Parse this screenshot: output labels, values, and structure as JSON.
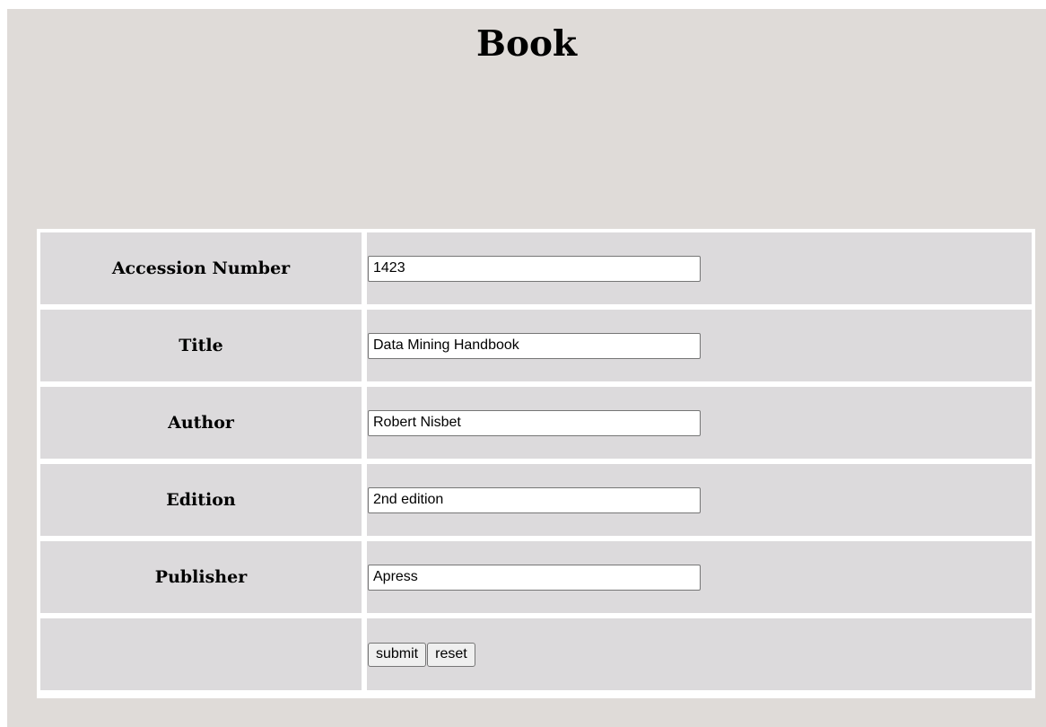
{
  "page": {
    "heading": "Book"
  },
  "form": {
    "fields": [
      {
        "label": "Accession Number",
        "value": "1423"
      },
      {
        "label": "Title",
        "value": "Data Mining Handbook"
      },
      {
        "label": "Author",
        "value": "Robert Nisbet"
      },
      {
        "label": "Edition",
        "value": "2nd edition"
      },
      {
        "label": "Publisher",
        "value": "Apress"
      }
    ],
    "submit_label": "submit",
    "reset_label": "reset"
  },
  "colors": {
    "page_background": "#dfdbd8",
    "cell_background": "#dcdadc",
    "table_border": "#ffffff"
  }
}
